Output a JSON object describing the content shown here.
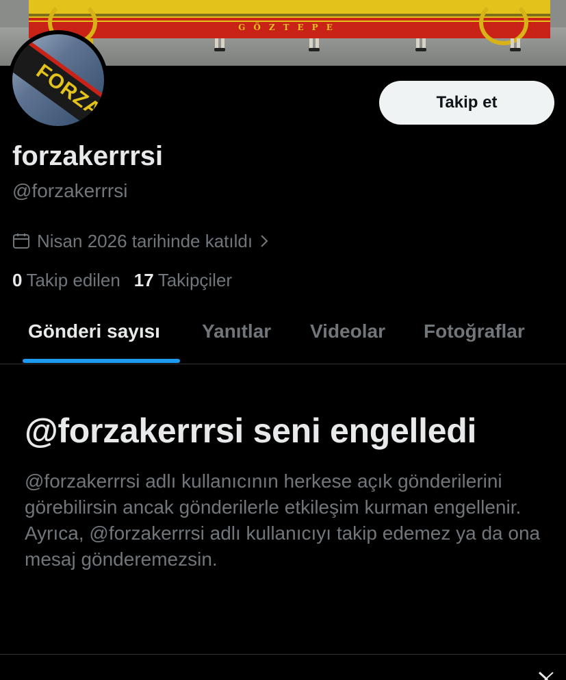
{
  "banner": {
    "flag_text": "GÖZTEPE"
  },
  "avatar": {
    "text": "FORZA"
  },
  "header": {
    "follow_label": "Takip et"
  },
  "profile": {
    "display_name": "forzakerrrsi",
    "handle": "@forzakerrrsi",
    "joined": "Nisan 2026 tarihinde katıldı"
  },
  "stats": {
    "following_count": "0",
    "following_label": "Takip edilen",
    "followers_count": "17",
    "followers_label": "Takipçiler"
  },
  "tabs": [
    {
      "label": "Gönderi sayısı"
    },
    {
      "label": "Yanıtlar"
    },
    {
      "label": "Videolar"
    },
    {
      "label": "Fotoğraflar"
    }
  ],
  "blocked": {
    "title": "@forzakerrrsi seni engelledi",
    "body": "@forzakerrrsi adlı kullanıcının herkese açık gönderilerini görebilirsin ancak gönderilerle etkileşim kurman engellenir. Ayrıca, @forzakerrrsi adlı kullanıcıyı takip edemez ya da ona mesaj gönderemezsin."
  },
  "colors": {
    "background": "#000000",
    "primary_text": "#e7e9ea",
    "secondary_text": "#71767b",
    "accent": "#1d9bf0",
    "button_bg": "#eff3f4"
  },
  "icons": {
    "joined": "calendar-icon",
    "joined_chevron": "chevron-right-icon",
    "corner": "x-logo-icon"
  }
}
